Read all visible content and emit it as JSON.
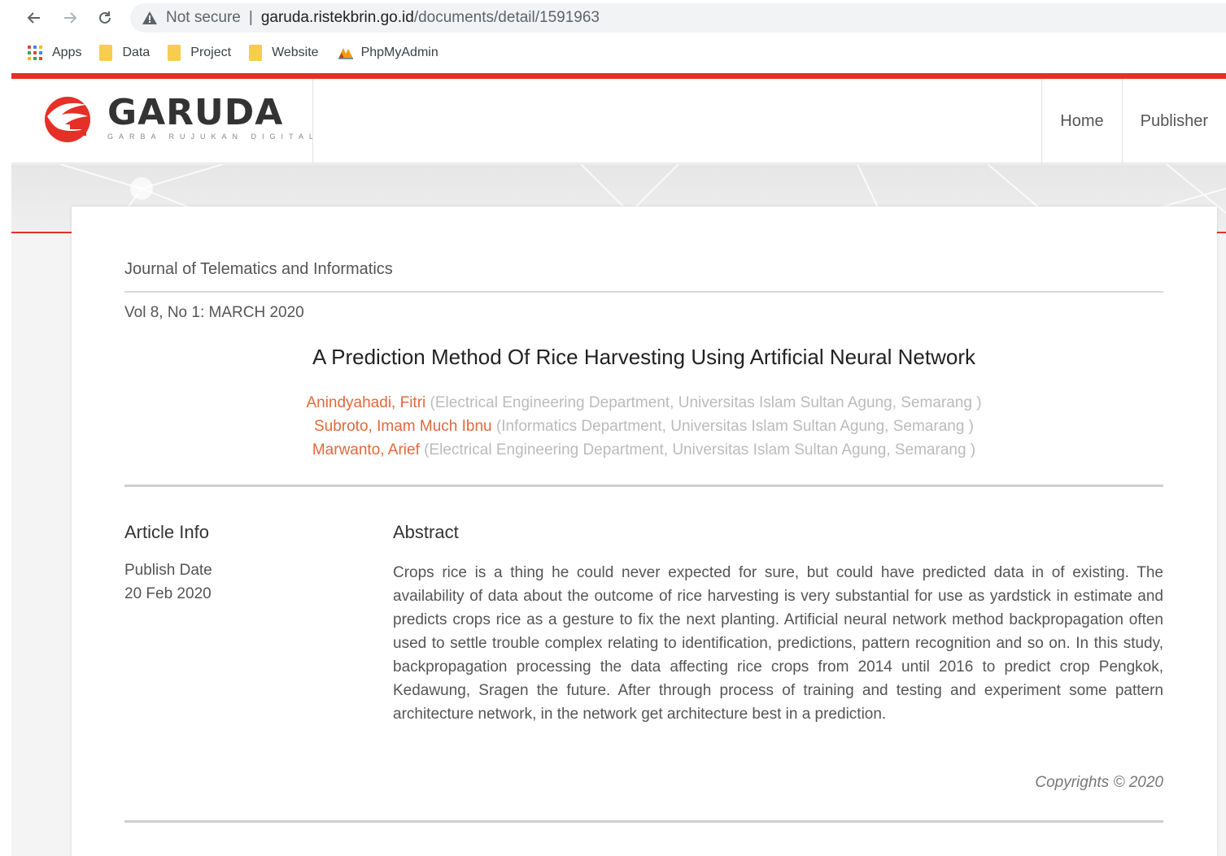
{
  "browser": {
    "security_label": "Not secure",
    "url_host": "garuda.ristekbrin.go.id",
    "url_path": "/documents/detail/1591963",
    "bookmarks": [
      {
        "label": "Apps",
        "icon": "apps-grid-icon"
      },
      {
        "label": "Data",
        "icon": "folder-icon"
      },
      {
        "label": "Project",
        "icon": "folder-icon"
      },
      {
        "label": "Website",
        "icon": "folder-icon"
      },
      {
        "label": "PhpMyAdmin",
        "icon": "phpmyadmin-icon"
      }
    ]
  },
  "site": {
    "brand": "GARUDA",
    "tagline": "GARBA RUJUKAN DIGITAL",
    "nav": [
      "Home",
      "Publisher"
    ],
    "accent_color": "#e53027"
  },
  "article": {
    "journal": "Journal of Telematics and Informatics",
    "volume": "Vol 8, No 1: MARCH 2020",
    "title": "A Prediction Method Of Rice Harvesting Using Artificial Neural Network",
    "authors": [
      {
        "name": "Anindyahadi, Fitri",
        "affiliation": "(Electrical Engineering Department, Universitas Islam Sultan Agung, Semarang )"
      },
      {
        "name": "Subroto, Imam Much Ibnu",
        "affiliation": "(Informatics Department, Universitas Islam Sultan Agung, Semarang )"
      },
      {
        "name": "Marwanto, Arief",
        "affiliation": "(Electrical Engineering Department, Universitas Islam Sultan Agung, Semarang )"
      }
    ],
    "info_heading": "Article Info",
    "publish_label": "Publish Date",
    "publish_date": "20 Feb 2020",
    "abstract_heading": "Abstract",
    "abstract": "Crops rice is a thing he could never expected for sure, but could have predicted data in of existing. The availability of data about the outcome of rice harvesting is very substantial for use as yardstick in estimate and predicts crops rice as a gesture to fix the next planting. Artificial neural network method backpropagation often used to settle trouble complex relating to identification, predictions, pattern recognition and so on. In this study, backpropagation processing the data affecting rice crops from 2014 until 2016 to predict crop Pengkok, Kedawung, Sragen the future. After through process of training and testing and experiment some pattern architecture network, in the network get architecture best in a prediction.",
    "copyright": "Copyrights © 2020"
  }
}
